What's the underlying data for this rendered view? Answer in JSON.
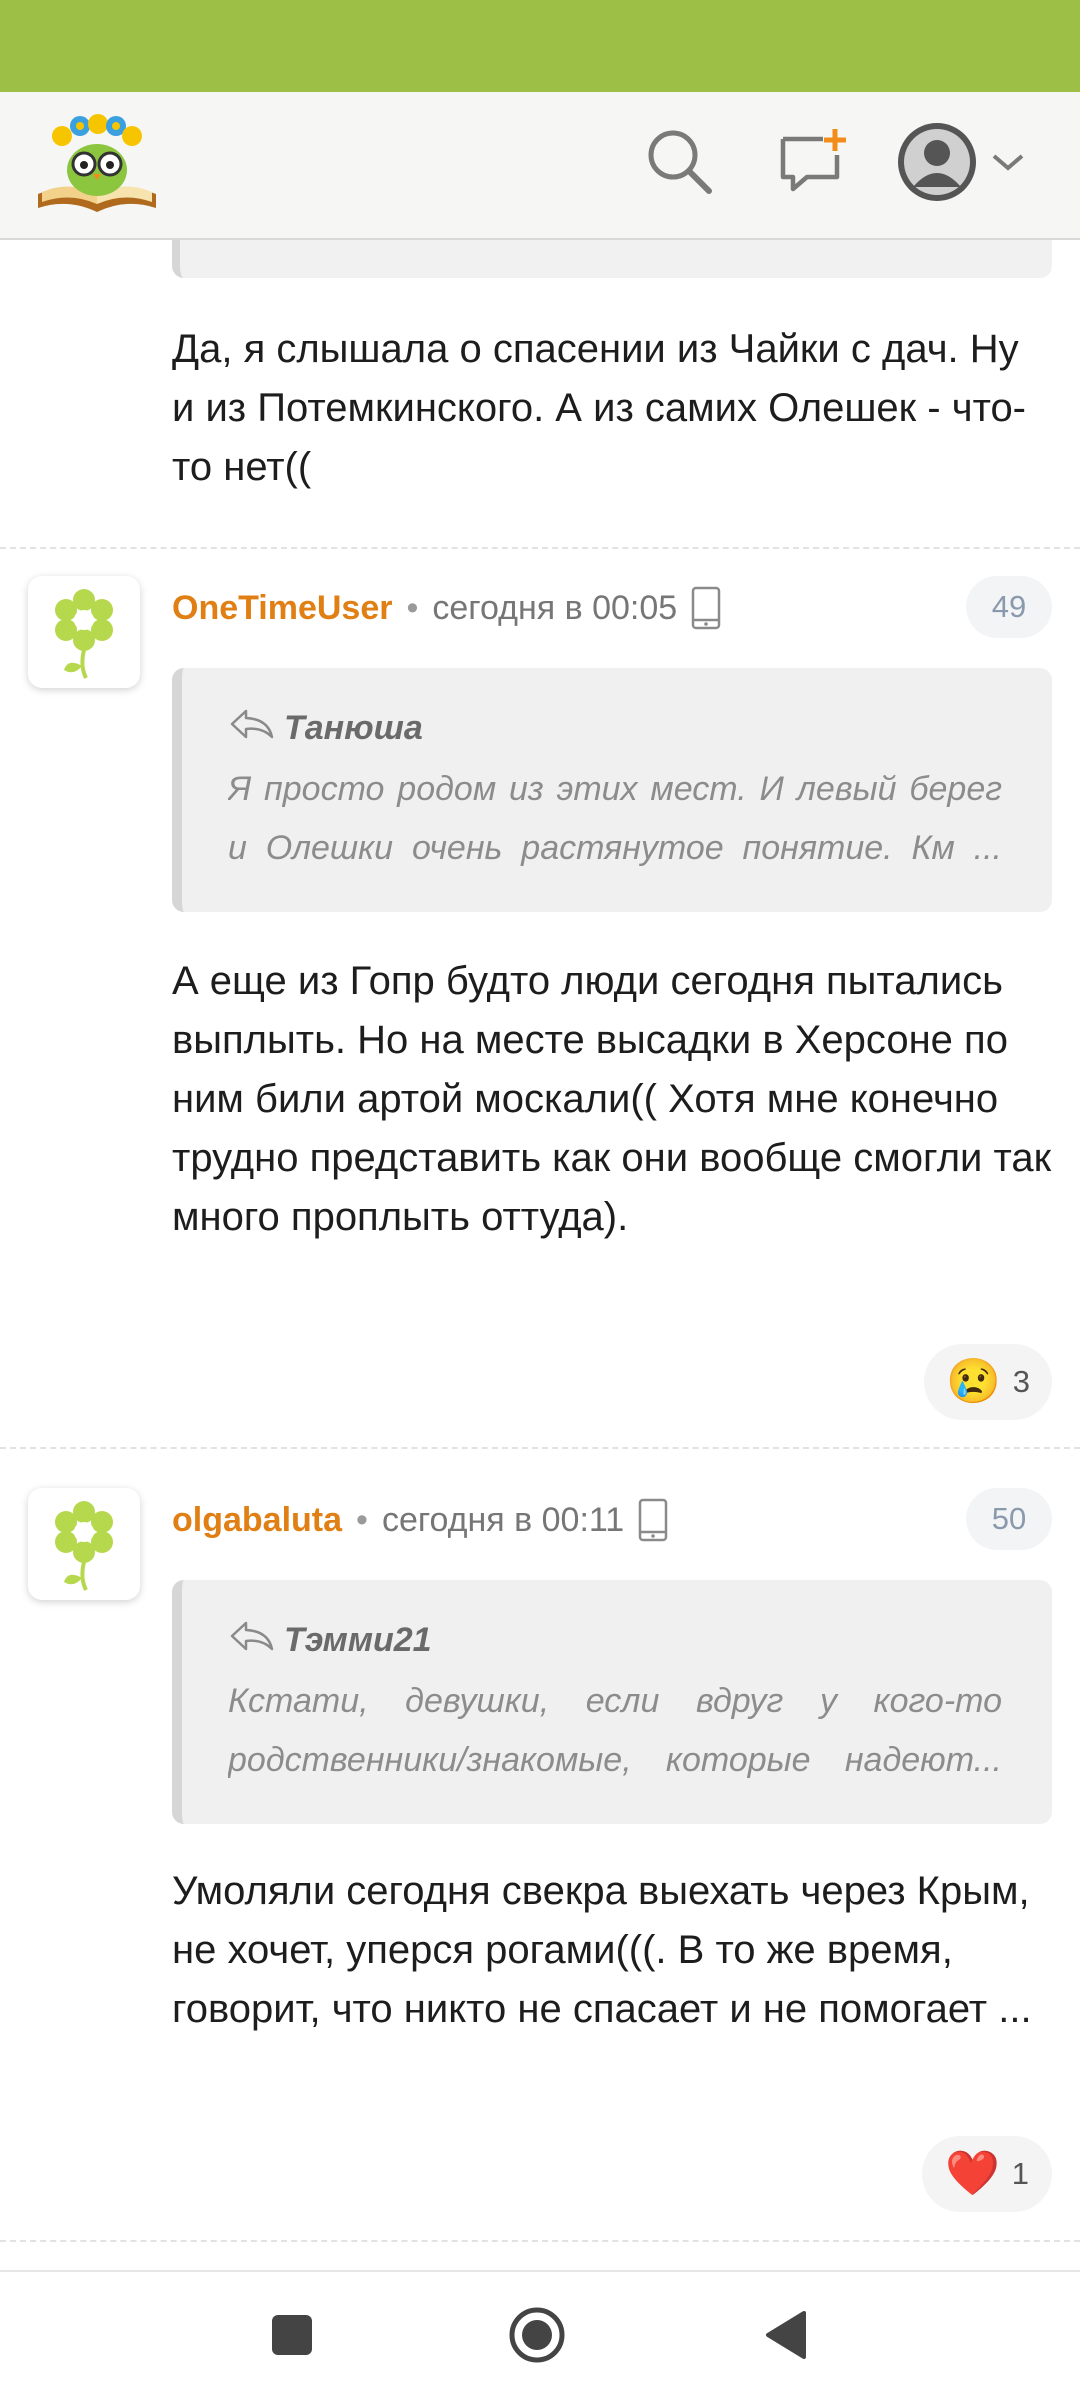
{
  "app": {
    "colors": {
      "accent_green": "#9ebf45",
      "username_orange": "#e07f14"
    }
  },
  "topbar": {
    "logo_icon": "owl-book-logo",
    "search_icon": "search-icon",
    "new_post_icon": "new-message-plus-icon",
    "account_icon": "user-avatar-icon",
    "account_dropdown_icon": "chevron-down-icon"
  },
  "previous_post": {
    "text": "Да, я слышала о спасении из Чайки с дач. Ну и из Потемкинского. А из самих Олешек - что-то нет(("
  },
  "posts": [
    {
      "username": "OneTimeUser",
      "separator": "•",
      "time": "сегодня в 00:05",
      "device_icon": "mobile-phone-icon",
      "number": "49",
      "quote": {
        "author": "Танюша",
        "line1": "Я просто родом из этих мест. И левый берег",
        "line2": "и Олешки очень растянутое понятие. Км ..."
      },
      "text": "А еще из Гопр будто люди сегодня пытались выплыть. Но на месте высадки в Херсоне по ним били артой москали(( Хотя мне конечно трудно представить как они вообще смогли так много проплыть оттуда).",
      "reaction": {
        "emoji": "😢",
        "count": "3"
      }
    },
    {
      "username": "olgabaluta",
      "separator": "•",
      "time": "сегодня в 00:11",
      "device_icon": "mobile-phone-icon",
      "number": "50",
      "quote": {
        "author": "Тэмми21",
        "line1": "Кстати, девушки, если вдруг у кого-то",
        "line2": "родственники/знакомые, которые надеют..."
      },
      "text": "Умоляли сегодня свекра выехать через Крым, не хочет, уперся рогами(((. В то же время, говорит, что никто не спасает и не помогает ...",
      "reaction": {
        "emoji": "❤️",
        "count": "1"
      }
    }
  ],
  "navbar": {
    "recents_icon": "square-recents-icon",
    "home_icon": "circle-home-icon",
    "back_icon": "triangle-back-icon"
  }
}
